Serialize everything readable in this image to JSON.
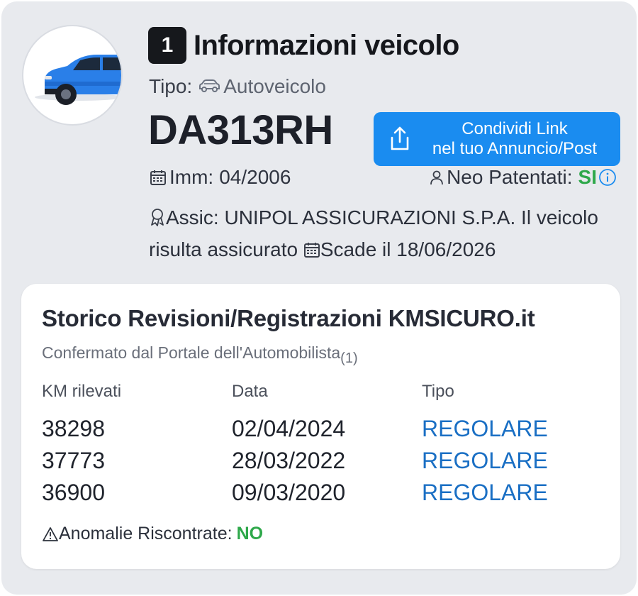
{
  "header": {
    "step_number": "1",
    "title": "Informazioni veicolo"
  },
  "vehicle": {
    "tipo_label": "Tipo:",
    "tipo_value": "Autoveicolo",
    "plate": "DA313RH",
    "imm_label": "Imm:",
    "imm_value": "04/2006",
    "neo_label": "Neo Patentati:",
    "neo_value": "SI",
    "assic_label": "Assic:",
    "assic_text": "UNIPOL ASSICURAZIONI S.P.A. Il veicolo risulta assicurato",
    "scade_label": "Scade il",
    "scade_value": "18/06/2026",
    "car_color": "#2a7fe8"
  },
  "share_button": {
    "line1": "Condividi Link",
    "line2": "nel tuo Annuncio/Post",
    "color": "#1a8cf0"
  },
  "history": {
    "title": "Storico Revisioni/Registrazioni KMSICURO.it",
    "subtitle": "Confermato dal Portale dell'Automobilista",
    "subtitle_ref": "(1)",
    "columns": [
      "KM rilevati",
      "Data",
      "Tipo"
    ],
    "rows": [
      {
        "km": "38298",
        "data": "02/04/2024",
        "tipo": "REGOLARE"
      },
      {
        "km": "37773",
        "data": "28/03/2022",
        "tipo": "REGOLARE"
      },
      {
        "km": "36900",
        "data": "09/03/2020",
        "tipo": "REGOLARE"
      }
    ],
    "anomalie_label": "Anomalie Riscontrate:",
    "anomalie_value": "NO",
    "status_color": "#2ea84a",
    "tipo_color": "#1a6fc4"
  }
}
